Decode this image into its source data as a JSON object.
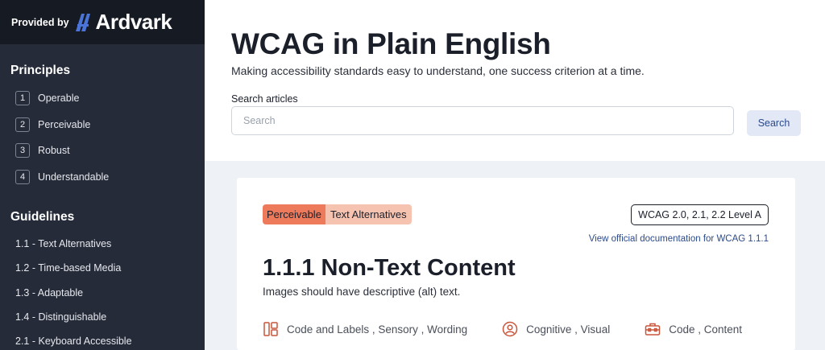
{
  "brand": {
    "provided_by": "Provided by",
    "logo_text": "Ardvark",
    "accent": "#4a74d8"
  },
  "sidebar": {
    "principles_title": "Principles",
    "principles": [
      {
        "num": "1",
        "label": "Operable"
      },
      {
        "num": "2",
        "label": "Perceivable"
      },
      {
        "num": "3",
        "label": "Robust"
      },
      {
        "num": "4",
        "label": "Understandable"
      }
    ],
    "guidelines_title": "Guidelines",
    "guidelines": [
      {
        "label": "1.1 - Text Alternatives"
      },
      {
        "label": "1.2 - Time-based Media"
      },
      {
        "label": "1.3 - Adaptable"
      },
      {
        "label": "1.4 - Distinguishable"
      },
      {
        "label": "2.1 - Keyboard Accessible"
      }
    ]
  },
  "header": {
    "title": "WCAG in Plain English",
    "subtitle": "Making accessibility standards easy to understand, one success criterion at a time.",
    "search_label": "Search articles",
    "search_placeholder": "Search",
    "search_value": "",
    "search_button": "Search"
  },
  "article": {
    "principle_tag": "Perceivable",
    "guideline_tag": "Text Alternatives",
    "level_badge": "WCAG 2.0, 2.1, 2.2 Level A",
    "doc_link": "View official documentation for WCAG 1.1.1",
    "title": "1.1.1 Non-Text Content",
    "summary": "Images should have descriptive (alt) text.",
    "categories": [
      {
        "icon": "layout-icon",
        "label": "Code and Labels , Sensory , Wording"
      },
      {
        "icon": "person-circle-icon",
        "label": "Cognitive , Visual"
      },
      {
        "icon": "toolbox-icon",
        "label": "Code , Content"
      }
    ],
    "icon_color": "#c9553a"
  }
}
